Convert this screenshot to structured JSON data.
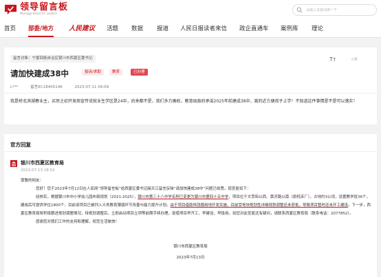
{
  "header": {
    "logo_main": "领导留言板",
    "logo_sub": "Message Board for Leaders",
    "search_placeholder": "请输入关键词搜一下"
  },
  "nav": {
    "items": [
      "首页",
      "部委/地方",
      "人民建议",
      "活题",
      "数据",
      "报道",
      "人民日报读者来信",
      "政企直通车",
      "案例库",
      "理论"
    ]
  },
  "message": {
    "target": "留言对象：宁夏回族自治区银川市西夏区委书记",
    "title": "请加快建成38中",
    "badges": [
      "投诉/求助",
      "教育",
      "已办理"
    ],
    "author": "L***",
    "message_id": "留言ID:18405146",
    "date": "2023-07-11 09:09",
    "font_button": "Tт",
    "likes": "☆0",
    "body": "我是桥北滨湖春业主，买房之初开发商宣传说就业生学区是24中，后来都不是，我们多方确权，教育局政府承诺2025年前建成38中，离的近方便孩子上学！不知道这件事情是不是可以落实！"
  },
  "reply": {
    "heading": "官方回复",
    "org_name": "银川市西夏区教育局",
    "date": "2023-07-13 18:52",
    "greeting": "尊敬的网友：",
    "p1": "您好！您于2023年7月12日在人民网“领导留言板”给西夏区委书记赫天江留言反映“请加快建成38中”问题已收悉，现答复如下：",
    "p2_a": "经核实，根据银川市中小学幼儿园布局规划（2021-2025），",
    "p2_hl1": "银川市第三十八中学名称已变更为银川市第四十五中学",
    "p2_b": "，项目位于文萃街以西、黄河路以南（原机床厂），占地约3公顷，设置教学班36个，建成后可提供学位1800个，目前该项目已被列入义务教育薄弱环节改善与能力提升计划。",
    "p2_hl2": "由于项目借助恒茂顺用地开发实施，目前受地块规划性详细规划调整还未获批，导致项目暂时还未开工建设",
    "p2_c": "。下一步，西夏区教育局将积极跟进规划调整情况，待规划调整后，立即启动项目立项等前期手续办理，促使项目早开工、早建设，早投用。如您对此答复还有疑问，请联系西夏区教育局（联系电话：2077852）。",
    "p3": "感谢您对我们工作的支持和理解，祝您生活愉快！",
    "sign_org": "银川市西夏区教育局",
    "sign_date": "2023年7月13日"
  },
  "colors": {
    "brand_red": "#c8161d"
  }
}
